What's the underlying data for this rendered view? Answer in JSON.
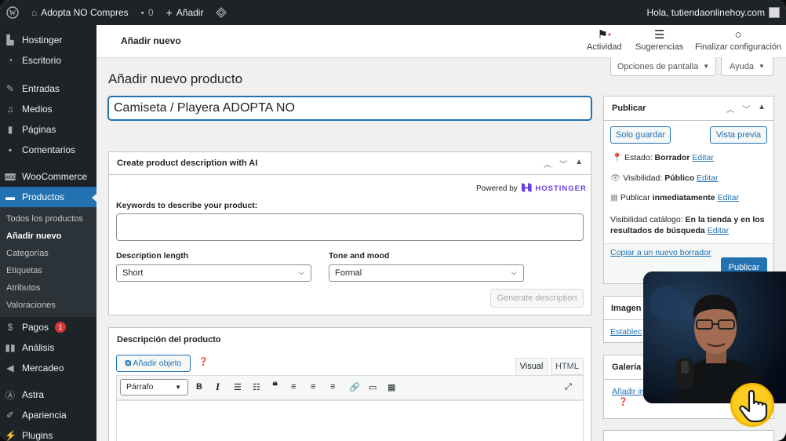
{
  "adminbar": {
    "site_name": "Adopta NO Compres",
    "comments_count": "0",
    "add_new": "Añadir",
    "greeting": "Hola, tutiendaonlinehoy.com"
  },
  "sidebar": {
    "items": [
      {
        "label": "Hostinger",
        "icon": "hostinger-icon"
      },
      {
        "label": "Escritorio",
        "icon": "dashboard-icon"
      },
      {
        "label": "Entradas",
        "icon": "pin-icon"
      },
      {
        "label": "Medios",
        "icon": "media-icon"
      },
      {
        "label": "Páginas",
        "icon": "page-icon"
      },
      {
        "label": "Comentarios",
        "icon": "comment-icon"
      },
      {
        "label": "WooCommerce",
        "icon": "woocommerce-icon"
      },
      {
        "label": "Productos",
        "icon": "products-icon"
      },
      {
        "label": "Pagos",
        "icon": "payments-icon",
        "badge": "1"
      },
      {
        "label": "Análisis",
        "icon": "analytics-icon"
      },
      {
        "label": "Mercadeo",
        "icon": "megaphone-icon"
      },
      {
        "label": "Astra",
        "icon": "astra-icon"
      },
      {
        "label": "Apariencia",
        "icon": "brush-icon"
      },
      {
        "label": "Plugins",
        "icon": "plugin-icon"
      }
    ],
    "products_submenu": [
      "Todos los productos",
      "Añadir nuevo",
      "Categorías",
      "Etiquetas",
      "Atributos",
      "Valoraciones"
    ]
  },
  "header": {
    "page_label": "Añadir nuevo",
    "activity": "Actividad",
    "suggestions": "Sugerencias",
    "finish_setup": "Finalizar configuración",
    "screen_options": "Opciones de pantalla",
    "help": "Ayuda"
  },
  "main": {
    "heading": "Añadir nuevo producto",
    "title_value": "Camiseta / Playera ADOPTA NO"
  },
  "ai_box": {
    "title": "Create product description with AI",
    "powered_by": "Powered by",
    "brand": "HOSTINGER",
    "keywords_label": "Keywords to describe your product:",
    "keywords_value": "",
    "length_label": "Description length",
    "length_value": "Short",
    "tone_label": "Tone and mood",
    "tone_value": "Formal",
    "generate_button": "Generate description"
  },
  "description_box": {
    "title": "Descripción del producto",
    "add_media": "Añadir objeto",
    "tab_visual": "Visual",
    "tab_html": "HTML",
    "format_value": "Párrafo"
  },
  "publish_box": {
    "title": "Publicar",
    "save_draft": "Solo guardar",
    "preview": "Vista previa",
    "status_label": "Estado:",
    "status_value": "Borrador",
    "visibility_label": "Visibilidad:",
    "visibility_value": "Público",
    "publish_label": "Publicar",
    "publish_value": "inmediatamente",
    "edit": "Editar",
    "catalog_label": "Visibilidad catálogo:",
    "catalog_value": "En la tienda y en los resultados de búsqueda",
    "copy_draft": "Copiar a un nuevo borrador",
    "publish_button": "Publicar"
  },
  "image_box": {
    "title": "Imagen",
    "link": "Estableс"
  },
  "gallery_box": {
    "title": "Galería",
    "link": "Añadir im"
  },
  "colors": {
    "accent": "#2271b1",
    "adminbar": "#1d2327",
    "badge": "#d63638"
  }
}
